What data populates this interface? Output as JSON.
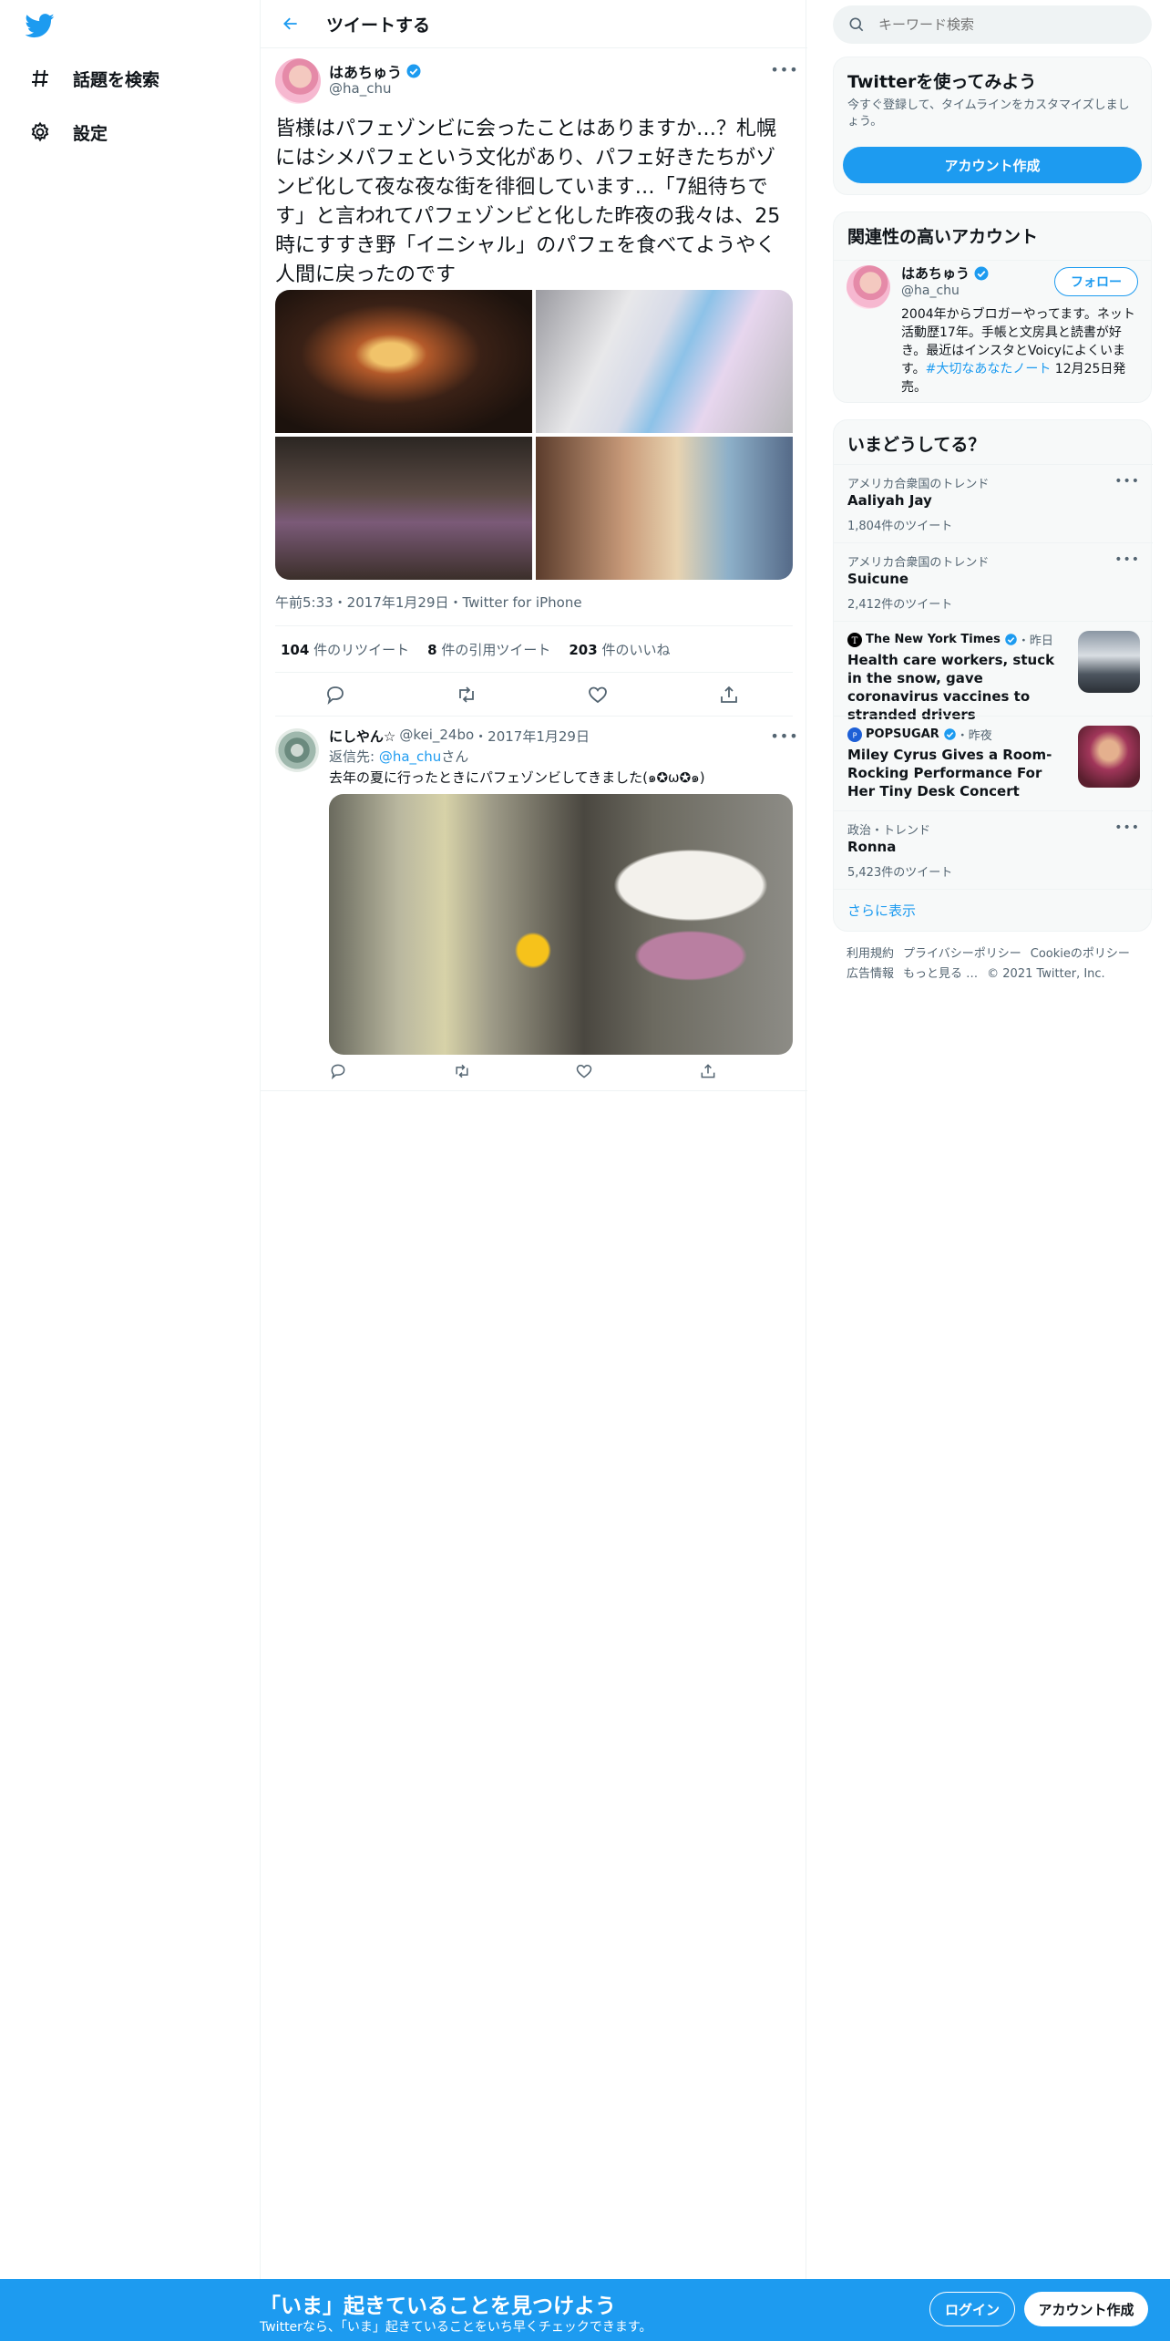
{
  "colors": {
    "brand": "#1d9bf0",
    "text": "#0f1419",
    "muted": "#536471",
    "border": "#eff3f4"
  },
  "nav": {
    "logo_icon": "twitter-bird-icon",
    "items": [
      {
        "icon": "hashtag-icon",
        "label": "話題を検索"
      },
      {
        "icon": "gear-icon",
        "label": "設定"
      }
    ]
  },
  "header": {
    "title": "ツイートする"
  },
  "tweet": {
    "name": "はあちゅう",
    "handle": "@ha_chu",
    "text": "皆様はパフェゾンビに会ったことはありますか…？札幌にはシメパフェという文化があり、パフェ好きたちがゾンビ化して夜な夜な街を徘徊しています…「7組待ちです」と言われてパフェゾンビと化した昨夜の我々は、25時にすすき野「イニシャル」のパフェを食べてようやく人間に戻ったのです",
    "meta": "午前5:33・2017年1月29日・Twitter for iPhone",
    "stats": {
      "retweets": "104",
      "retweets_label": "件のリツイート",
      "quotes": "8",
      "quotes_label": "件の引用ツイート",
      "likes": "203",
      "likes_label": "件のいいね"
    }
  },
  "reply": {
    "name": "にしやん☆",
    "handle": "@kei_24bo",
    "date": "・2017年1月29日",
    "reply_to_prefix": "返信先: ",
    "reply_to_handle": "@ha_chu",
    "reply_to_suffix": "さん",
    "text": "去年の夏に行ったときにパフェゾンビしてきました(๑✪ω✪๑)"
  },
  "search": {
    "placeholder": "キーワード検索"
  },
  "signup_card": {
    "title": "Twitterを使ってみよう",
    "subtitle": "今すぐ登録して、タイムラインをカスタマイズしましょう。",
    "button": "アカウント作成"
  },
  "related": {
    "title": "関連性の高いアカウント",
    "name": "はあちゅう",
    "handle": "@ha_chu",
    "follow": "フォロー",
    "bio_before": "2004年からブロガーやってます。ネット活動歴17年。手帳と文房具と読書が好き。最近はインスタとVoicyによくいます。",
    "bio_link": "#大切なあなたノート",
    "bio_after": " 12月25日発売。"
  },
  "trends": {
    "title": "いまどうしてる？",
    "items": [
      {
        "context": "アメリカ合衆国のトレンド",
        "name": "Aaliyah Jay",
        "count": "1,804件のツイート"
      },
      {
        "context": "アメリカ合衆国のトレンド",
        "name": "Suicune",
        "count": "2,412件のツイート"
      },
      {
        "context": "政治・トレンド",
        "name": "Ronna",
        "count": "5,423件のツイート"
      }
    ],
    "news": [
      {
        "source": "The New York Times",
        "time": "・昨日",
        "title": "Health care workers, stuck in the snow, gave coronavirus vaccines to stranded drivers"
      },
      {
        "source": "POPSUGAR",
        "time": "・昨夜",
        "title": "Miley Cyrus Gives a Room-Rocking Performance For Her Tiny Desk Concert"
      }
    ],
    "show_more": "さらに表示"
  },
  "footer": {
    "links": [
      "利用規約",
      "プライバシーポリシー",
      "Cookieのポリシー",
      "広告情報",
      "もっと見る …",
      "© 2021 Twitter, Inc."
    ]
  },
  "bottom_bar": {
    "title": "「いま」起きていることを見つけよう",
    "subtitle": "Twitterなら、「いま」起きていることをいち早くチェックできます。",
    "login": "ログイン",
    "signup": "アカウント作成"
  }
}
